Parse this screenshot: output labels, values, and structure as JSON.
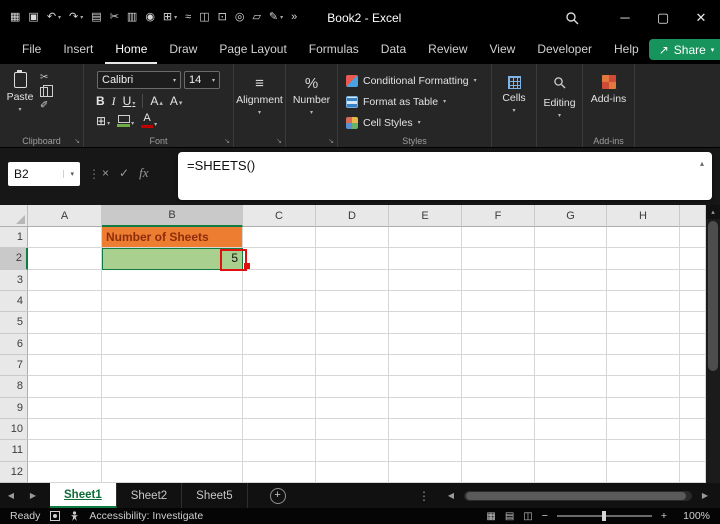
{
  "titlebar": {
    "title": "Book2 - Excel",
    "qat_icons": [
      {
        "name": "ribbon-options-icon",
        "glyph": "▦"
      },
      {
        "name": "save-icon",
        "glyph": "▣"
      },
      {
        "name": "undo-icon",
        "glyph": "↶",
        "dropdown": true
      },
      {
        "name": "redo-icon",
        "glyph": "↷",
        "dropdown": true
      },
      {
        "name": "workbook-icon",
        "glyph": "▤"
      },
      {
        "name": "cut-icon",
        "glyph": "✂"
      },
      {
        "name": "chart-icon",
        "glyph": "▥"
      },
      {
        "name": "view-icon",
        "glyph": "◉"
      },
      {
        "name": "table-icon",
        "glyph": "⊞",
        "dropdown": true
      },
      {
        "name": "draw-icon",
        "glyph": "≈"
      },
      {
        "name": "document-icon",
        "glyph": "◫"
      },
      {
        "name": "pivot-icon",
        "glyph": "⊡"
      },
      {
        "name": "camera-icon",
        "glyph": "◎"
      },
      {
        "name": "new-file-icon",
        "glyph": "▱"
      },
      {
        "name": "pen-icon",
        "glyph": "✎",
        "dropdown": true
      },
      {
        "name": "more-commands-icon",
        "glyph": "»"
      }
    ]
  },
  "menubar": {
    "tabs": [
      {
        "label": "File"
      },
      {
        "label": "Insert"
      },
      {
        "label": "Home",
        "active": true
      },
      {
        "label": "Draw"
      },
      {
        "label": "Page Layout"
      },
      {
        "label": "Formulas"
      },
      {
        "label": "Data"
      },
      {
        "label": "Review"
      },
      {
        "label": "View"
      },
      {
        "label": "Developer"
      },
      {
        "label": "Help"
      }
    ],
    "share_label": "Share"
  },
  "ribbon": {
    "clipboard": {
      "paste_label": "Paste",
      "group_label": "Clipboard"
    },
    "font": {
      "font_name": "Calibri",
      "font_size": "14",
      "bold": "B",
      "italic": "I",
      "underline": "U",
      "grow_letter": "A",
      "shrink_letter": "A",
      "color_letter": "A",
      "group_label": "Font"
    },
    "alignment": {
      "label": "Alignment"
    },
    "number": {
      "label": "Number"
    },
    "styles": {
      "items": [
        "Conditional Formatting",
        "Format as Table",
        "Cell Styles"
      ],
      "group_label": "Styles"
    },
    "cells": {
      "label": "Cells"
    },
    "editing": {
      "label": "Editing"
    },
    "addins": {
      "label": "Add-ins",
      "group_label": "Add-ins"
    }
  },
  "formula_bar": {
    "name_box": "B2",
    "cancel": "×",
    "enter": "✓",
    "fx": "fx",
    "formula": "=SHEETS()"
  },
  "grid": {
    "column_headers": [
      "A",
      "B",
      "C",
      "D",
      "E",
      "F",
      "G",
      "H"
    ],
    "selected_column_index": 1,
    "row_count": 12,
    "selected_row": 2,
    "cells": [
      {
        "col": 1,
        "row": 1,
        "text": "Number of Sheets",
        "fill": "#ED7D31",
        "color": "#8E2D0B",
        "bold": true,
        "align": "left"
      },
      {
        "col": 1,
        "row": 2,
        "text": "5",
        "fill": "#A9D08E",
        "color": "#111111",
        "align": "right",
        "selected": true
      }
    ]
  },
  "sheet_tabs": {
    "tabs": [
      {
        "label": "Sheet1",
        "active": true
      },
      {
        "label": "Sheet2"
      },
      {
        "label": "Sheet5"
      }
    ],
    "add_label": "+"
  },
  "status_bar": {
    "ready": "Ready",
    "accessibility": "Accessibility: Investigate",
    "zoom_out": "−",
    "zoom_in": "+",
    "zoom": "100%"
  },
  "colors": {
    "accent_green": "#107C41",
    "share_green": "#17935C",
    "annotation_red": "#E01010",
    "b1_fill": "#ED7D31",
    "b2_fill": "#A9D08E"
  }
}
